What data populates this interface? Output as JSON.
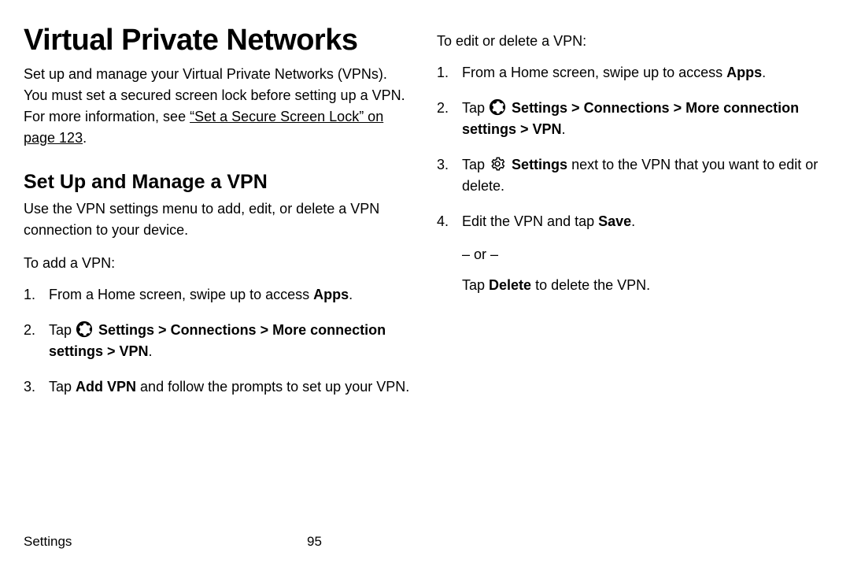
{
  "title": "Virtual Private Networks",
  "intro_pre": "Set up and manage your Virtual Private Networks (VPNs). You must set a secured screen lock before setting up a VPN. For more information, see ",
  "intro_link": "“Set a Secure Screen Lock” on page 123",
  "intro_post": ".",
  "section_heading": "Set Up and Manage a VPN",
  "section_body": "Use the VPN settings menu to add, edit, or delete a VPN connection to your device.",
  "add_vpn_intro": "To add a VPN:",
  "steps_add": {
    "s1_pre": "From a Home screen, swipe up to access ",
    "s1_bold": "Apps",
    "s1_post": ".",
    "s2_pre": "Tap ",
    "s2_bold": "Settings > Connections > More connection settings > VPN",
    "s2_post": ".",
    "s3_pre": "Tap ",
    "s3_bold": "Add VPN",
    "s3_post": " and follow the prompts to set up your VPN."
  },
  "edit_vpn_intro": "To edit or delete a VPN:",
  "steps_edit": {
    "s1_pre": "From a Home screen, swipe up to access ",
    "s1_bold": "Apps",
    "s1_post": ".",
    "s2_pre": "Tap ",
    "s2_bold": "Settings > Connections > More connection settings > VPN",
    "s2_post": ".",
    "s3_pre": "Tap ",
    "s3_bold": "Settings",
    "s3_post": " next to the VPN that you want to edit or delete.",
    "s4_pre": "Edit the VPN and tap ",
    "s4_bold": "Save",
    "s4_post": "."
  },
  "or_text": "– or –",
  "delete_pre": "Tap ",
  "delete_bold": "Delete",
  "delete_post": " to delete the VPN.",
  "footer_section": "Settings",
  "footer_page": "95"
}
